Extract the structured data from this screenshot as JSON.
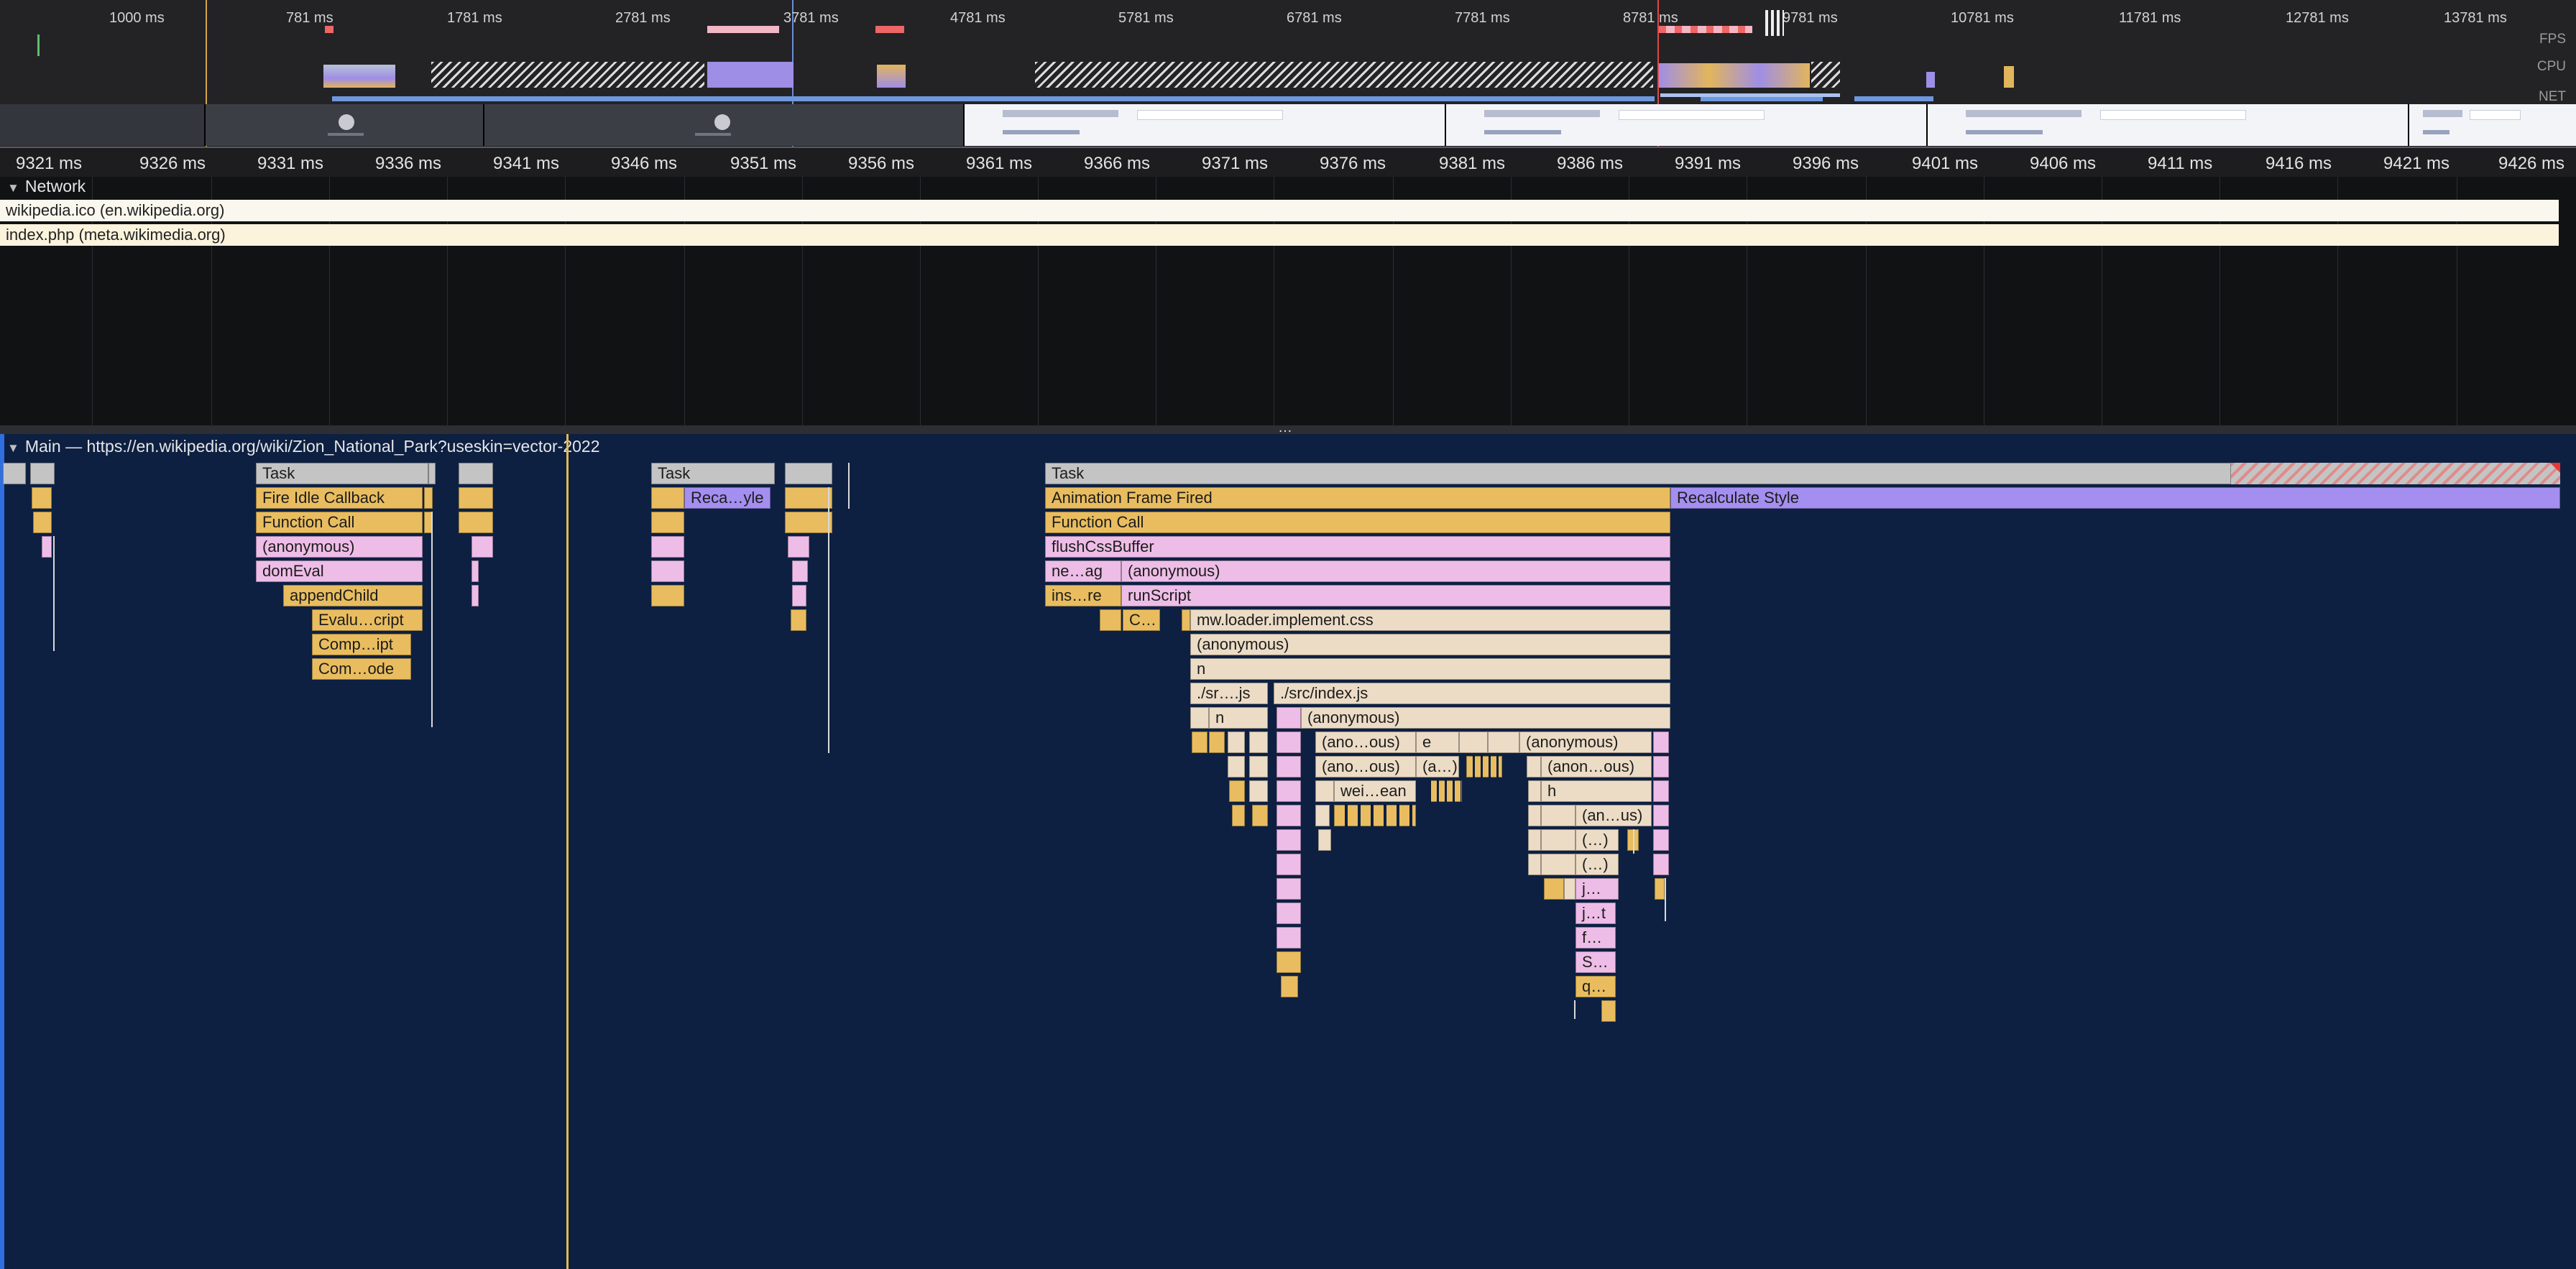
{
  "overview": {
    "ticks": [
      "1000 ms",
      "781 ms",
      "1781 ms",
      "2781 ms",
      "3781 ms",
      "4781 ms",
      "5781 ms",
      "6781 ms",
      "7781 ms",
      "8781 ms",
      "9781 ms",
      "10781 ms",
      "11781 ms",
      "12781 ms",
      "13781 ms"
    ],
    "labels": {
      "fps": "FPS",
      "cpu": "CPU",
      "net": "NET"
    }
  },
  "ruler": {
    "ticks": [
      "9321 ms",
      "9326 ms",
      "9331 ms",
      "9336 ms",
      "9341 ms",
      "9346 ms",
      "9351 ms",
      "9356 ms",
      "9361 ms",
      "9366 ms",
      "9371 ms",
      "9376 ms",
      "9381 ms",
      "9386 ms",
      "9391 ms",
      "9396 ms",
      "9401 ms",
      "9406 ms",
      "9411 ms",
      "9416 ms",
      "9421 ms",
      "9426 ms"
    ]
  },
  "network": {
    "title": "Network",
    "requests": [
      "wikipedia.ico (en.wikipedia.org)",
      "index.php (meta.wikimedia.org)"
    ]
  },
  "splitter": "…",
  "main": {
    "title": "Main — https://en.wikipedia.org/wiki/Zion_National_Park?useskin=vector-2022",
    "events": {
      "task1": "Task",
      "fic": "Fire Idle Callback",
      "fc1": "Function Call",
      "anon1": "(anonymous)",
      "domeval": "domEval",
      "append": "appendChild",
      "evalu": "Evalu…cript",
      "comp": "Comp…ipt",
      "com": "Com…ode",
      "task2": "Task",
      "reca": "Reca…yle",
      "task3": "Task",
      "aff": "Animation Frame Fired",
      "recalc": "Recalculate Style",
      "fc2": "Function Call",
      "flush": "flushCssBuffer",
      "neag": "ne…ag",
      "anon2": "(anonymous)",
      "insre": "ins…re",
      "runscript": "runScript",
      "c": "C…",
      "mwloader": "mw.loader.implement.css",
      "anon3": "(anonymous)",
      "n1": "n",
      "srcjs1": "./sr….js",
      "srcjs2": "./src/index.js",
      "n2": "n",
      "anon4": "(anonymous)",
      "anoous1": "(ano…ous)",
      "e": "e",
      "anon5": "(anonymous)",
      "anoous2": "(ano…ous)",
      "a": "(a…)",
      "anonous3": "(anon…ous)",
      "weiean": "wei…ean",
      "h": "h",
      "anus": "(an…us)",
      "p1": "(…)",
      "p2": "(…)",
      "j1": "j…",
      "jt": "j…t",
      "f": "f…",
      "s": "S…",
      "q": "q…"
    }
  }
}
